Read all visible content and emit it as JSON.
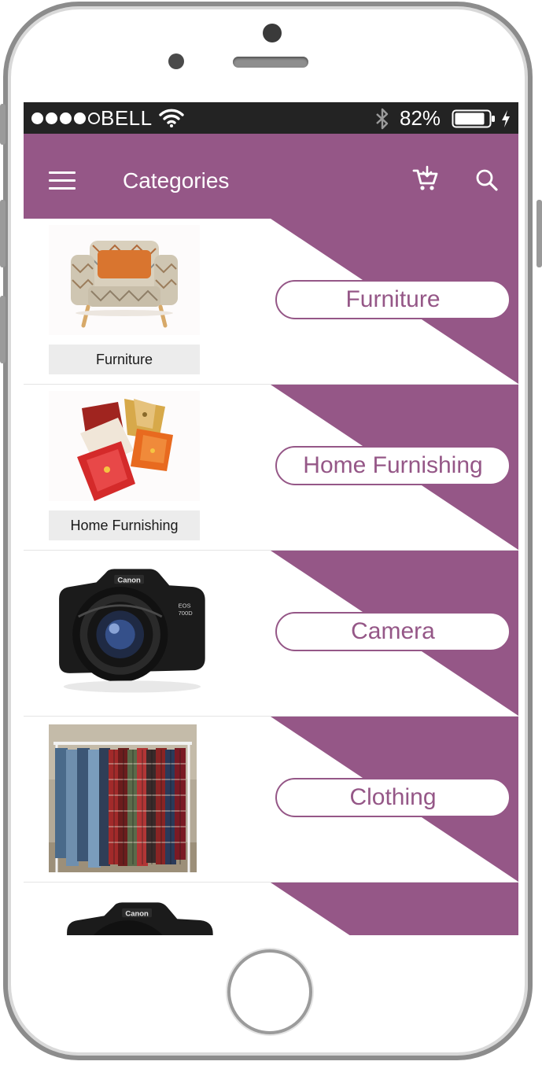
{
  "status_bar": {
    "carrier": "BELL",
    "battery_percent": "82%",
    "signal_bars_filled": 4,
    "signal_bars_total": 5,
    "icons": [
      "wifi-icon",
      "bluetooth-icon",
      "battery-icon",
      "charging-icon"
    ]
  },
  "app_bar": {
    "title": "Categories",
    "icons": [
      "menu-icon",
      "cart-icon",
      "search-icon"
    ]
  },
  "categories": [
    {
      "pill_label": "Furniture",
      "caption": "Furniture",
      "image": "armchair"
    },
    {
      "pill_label": "Home Furnishing",
      "caption": "Home Furnishing",
      "image": "cushions"
    },
    {
      "pill_label": "Camera",
      "caption": "",
      "image": "dslr-camera"
    },
    {
      "pill_label": "Clothing",
      "caption": "",
      "image": "clothes-rack"
    },
    {
      "pill_label": "",
      "caption": "",
      "image": "dslr-camera"
    }
  ],
  "colors": {
    "accent": "#955787",
    "status_bar": "#232323",
    "caption_bg": "#ececec"
  },
  "device": {
    "icons": [
      "front-camera-icon",
      "speaker-grille",
      "home-button"
    ]
  }
}
